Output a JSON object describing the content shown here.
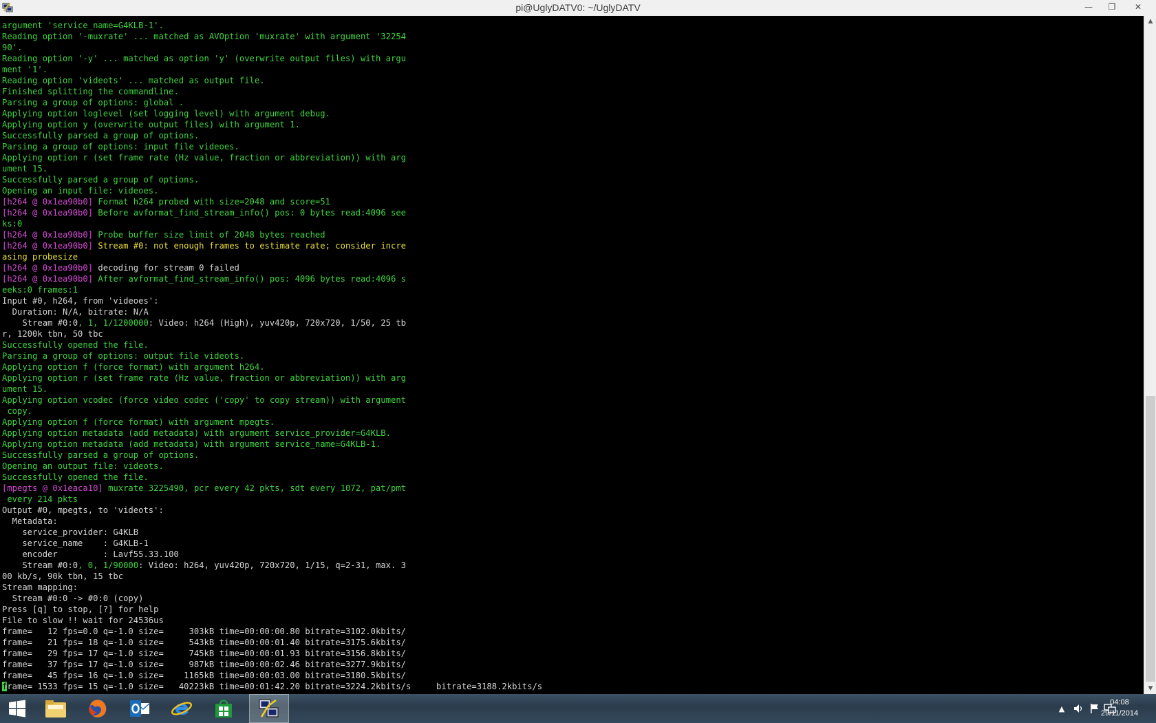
{
  "window": {
    "title": "pi@UglyDATV0: ~/UglyDATV",
    "minimize_glyph": "—",
    "maximize_glyph": "❐",
    "close_glyph": "✕"
  },
  "terminal": {
    "lines": [
      [
        {
          "t": "argument 'service_name=G4KLB-1'.",
          "c": "g"
        }
      ],
      [
        {
          "t": "Reading option '-muxrate' ... matched as AVOption 'muxrate' with argument '32254",
          "c": "g"
        }
      ],
      [
        {
          "t": "90'.",
          "c": "g"
        }
      ],
      [
        {
          "t": "Reading option '-y' ... matched as option 'y' (overwrite output files) with argu",
          "c": "g"
        }
      ],
      [
        {
          "t": "ment '1'.",
          "c": "g"
        }
      ],
      [
        {
          "t": "Reading option 'videots' ... matched as output file.",
          "c": "g"
        }
      ],
      [
        {
          "t": "Finished splitting the commandline.",
          "c": "g"
        }
      ],
      [
        {
          "t": "Parsing a group of options: global .",
          "c": "g"
        }
      ],
      [
        {
          "t": "Applying option loglevel (set logging level) with argument debug.",
          "c": "g"
        }
      ],
      [
        {
          "t": "Applying option y (overwrite output files) with argument 1.",
          "c": "g"
        }
      ],
      [
        {
          "t": "Successfully parsed a group of options.",
          "c": "g"
        }
      ],
      [
        {
          "t": "Parsing a group of options: input file videoes.",
          "c": "g"
        }
      ],
      [
        {
          "t": "Applying option r (set frame rate (Hz value, fraction or abbreviation)) with arg",
          "c": "g"
        }
      ],
      [
        {
          "t": "ument 15.",
          "c": "g"
        }
      ],
      [
        {
          "t": "Successfully parsed a group of options.",
          "c": "g"
        }
      ],
      [
        {
          "t": "Opening an input file: videoes.",
          "c": "g"
        }
      ],
      [
        {
          "t": "[h264 @ 0x1ea90b0]",
          "c": "m"
        },
        {
          "t": " Format h264 probed with size=2048 and score=51",
          "c": "g"
        }
      ],
      [
        {
          "t": "[h264 @ 0x1ea90b0]",
          "c": "m"
        },
        {
          "t": " Before avformat_find_stream_info() pos: 0 bytes read:4096 see",
          "c": "g"
        }
      ],
      [
        {
          "t": "ks:0",
          "c": "g"
        }
      ],
      [
        {
          "t": "[h264 @ 0x1ea90b0]",
          "c": "m"
        },
        {
          "t": " Probe buffer size limit of 2048 bytes reached",
          "c": "g"
        }
      ],
      [
        {
          "t": "[h264 @ 0x1ea90b0]",
          "c": "m"
        },
        {
          "t": " Stream #0: not enough frames to estimate rate; consider incre",
          "c": "y"
        }
      ],
      [
        {
          "t": "asing probesize",
          "c": "y"
        }
      ],
      [
        {
          "t": "[h264 @ 0x1ea90b0]",
          "c": "m"
        },
        {
          "t": " decoding for stream 0 failed",
          "c": "w"
        }
      ],
      [
        {
          "t": "[h264 @ 0x1ea90b0]",
          "c": "m"
        },
        {
          "t": " After avformat_find_stream_info() pos: 4096 bytes read:4096 s",
          "c": "g"
        }
      ],
      [
        {
          "t": "eeks:0 frames:1",
          "c": "g"
        }
      ],
      [
        {
          "t": "Input #0, h264, from 'videoes':",
          "c": "w"
        }
      ],
      [
        {
          "t": "  Duration: N/A, bitrate: N/A",
          "c": "w"
        }
      ],
      [
        {
          "t": "    Stream #0:0",
          "c": "w"
        },
        {
          "t": ", 1, 1/1200000",
          "c": "g"
        },
        {
          "t": ": Video: h264 (High), yuv420p, 720x720, 1/50, 25 tb",
          "c": "w"
        }
      ],
      [
        {
          "t": "r, 1200k tbn, 50 tbc",
          "c": "w"
        }
      ],
      [
        {
          "t": "Successfully opened the file.",
          "c": "g"
        }
      ],
      [
        {
          "t": "Parsing a group of options: output file videots.",
          "c": "g"
        }
      ],
      [
        {
          "t": "Applying option f (force format) with argument h264.",
          "c": "g"
        }
      ],
      [
        {
          "t": "Applying option r (set frame rate (Hz value, fraction or abbreviation)) with arg",
          "c": "g"
        }
      ],
      [
        {
          "t": "ument 15.",
          "c": "g"
        }
      ],
      [
        {
          "t": "Applying option vcodec (force video codec ('copy' to copy stream)) with argument",
          "c": "g"
        }
      ],
      [
        {
          "t": " copy.",
          "c": "g"
        }
      ],
      [
        {
          "t": "Applying option f (force format) with argument mpegts.",
          "c": "g"
        }
      ],
      [
        {
          "t": "Applying option metadata (add metadata) with argument service_provider=G4KLB.",
          "c": "g"
        }
      ],
      [
        {
          "t": "Applying option metadata (add metadata) with argument service_name=G4KLB-1.",
          "c": "g"
        }
      ],
      [
        {
          "t": "Successfully parsed a group of options.",
          "c": "g"
        }
      ],
      [
        {
          "t": "Opening an output file: videots.",
          "c": "g"
        }
      ],
      [
        {
          "t": "Successfully opened the file.",
          "c": "g"
        }
      ],
      [
        {
          "t": "[mpegts @ 0x1eaca10]",
          "c": "m"
        },
        {
          "t": " muxrate 3225490, pcr every 42 pkts, sdt every 1072, pat/pmt",
          "c": "g"
        }
      ],
      [
        {
          "t": " every 214 pkts",
          "c": "g"
        }
      ],
      [
        {
          "t": "Output #0, mpegts, to 'videots':",
          "c": "w"
        }
      ],
      [
        {
          "t": "  Metadata:",
          "c": "w"
        }
      ],
      [
        {
          "t": "    service_provider: G4KLB",
          "c": "w"
        }
      ],
      [
        {
          "t": "    service_name    : G4KLB-1",
          "c": "w"
        }
      ],
      [
        {
          "t": "    encoder         : Lavf55.33.100",
          "c": "w"
        }
      ],
      [
        {
          "t": "    Stream #0:0",
          "c": "w"
        },
        {
          "t": ", 0, 1/90000",
          "c": "g"
        },
        {
          "t": ": Video: h264, yuv420p, 720x720, 1/15, q=2-31, max. 3",
          "c": "w"
        }
      ],
      [
        {
          "t": "00 kb/s, 90k tbn, 15 tbc",
          "c": "w"
        }
      ],
      [
        {
          "t": "Stream mapping:",
          "c": "w"
        }
      ],
      [
        {
          "t": "  Stream #0:0 -> #0:0 (copy)",
          "c": "w"
        }
      ],
      [
        {
          "t": "Press [q] to stop, [?] for help",
          "c": "w"
        }
      ],
      [
        {
          "t": "File to slow !! wait for 24536us",
          "c": "w"
        }
      ],
      [
        {
          "t": "frame=   12 fps=0.0 q=-1.0 size=     303kB time=00:00:00.80 bitrate=3102.0kbits/",
          "c": "w"
        }
      ],
      [
        {
          "t": "frame=   21 fps= 18 q=-1.0 size=     543kB time=00:00:01.40 bitrate=3175.6kbits/",
          "c": "w"
        }
      ],
      [
        {
          "t": "frame=   29 fps= 17 q=-1.0 size=     745kB time=00:00:01.93 bitrate=3156.8kbits/",
          "c": "w"
        }
      ],
      [
        {
          "t": "frame=   37 fps= 17 q=-1.0 size=     987kB time=00:00:02.46 bitrate=3277.9kbits/",
          "c": "w"
        }
      ],
      [
        {
          "t": "frame=   45 fps= 16 q=-1.0 size=    1165kB time=00:00:03.00 bitrate=3180.5kbits/",
          "c": "w"
        }
      ],
      [
        {
          "t": "f",
          "c": "cursor"
        },
        {
          "t": "rame= 1533 fps= 15 q=-1.0 size=   40223kB time=00:01:42.20 bitrate=3224.2kbits/s     bitrate=3188.2kbits/s",
          "c": "w"
        }
      ]
    ]
  },
  "taskbar": {
    "items": [
      "start-icon",
      "file-explorer-icon",
      "firefox-icon",
      "outlook-icon",
      "internet-explorer-icon",
      "store-icon",
      "putty-icon"
    ],
    "active_item": "putty-icon",
    "clock_time": "04:08",
    "clock_date": "29/11/2014"
  },
  "colors": {
    "terminal_green": "#3fd43f",
    "terminal_white": "#d6d6d6",
    "terminal_magenta": "#d64ad6",
    "terminal_yellow": "#e8dd3a",
    "taskbar": "#2f4253"
  }
}
